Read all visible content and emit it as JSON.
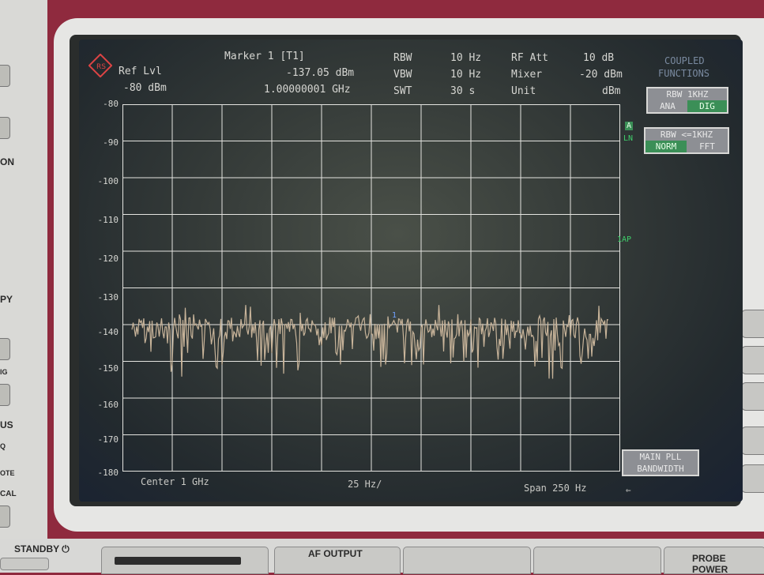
{
  "left_panel": {
    "labels": [
      "ON",
      "PY",
      "IG",
      "US",
      "Q",
      "OTE",
      "CAL"
    ]
  },
  "bottom_panel": {
    "standby": "STANDBY",
    "power_icon": "power-icon",
    "af_output": "AF OUTPUT",
    "probe_power": "PROBE POWER"
  },
  "screen": {
    "logo": "rohde-schwarz-logo",
    "ref_lvl_label": "Ref Lvl",
    "ref_lvl_value": "-80 dBm",
    "marker_label": "Marker 1 [T1]",
    "marker_level": "-137.05 dBm",
    "marker_freq": "1.00000001 GHz",
    "rbw_label": "RBW",
    "rbw_value": "10 Hz",
    "vbw_label": "VBW",
    "vbw_value": "10 Hz",
    "swt_label": "SWT",
    "swt_value": "30 s",
    "rf_att_label": "RF Att",
    "rf_att_value": "10 dB",
    "mixer_label": "Mixer",
    "mixer_value": "-20 dBm",
    "unit_label": "Unit",
    "unit_value": "dBm",
    "trace_a": "A",
    "trace_lin": "LN",
    "trace_1ap": "1AP",
    "marker_tag": "1",
    "center_label": "Center 1 GHz",
    "div_label": "25 Hz/",
    "span_label": "Span 250 Hz",
    "y_ticks": [
      "-80",
      "-90",
      "-100",
      "-110",
      "-120",
      "-130",
      "-140",
      "-150",
      "-160",
      "-170",
      "-180"
    ]
  },
  "softkeys": {
    "coupled_functions_line1": "COUPLED",
    "coupled_functions_line2": "FUNCTIONS",
    "rbw_1khz_title": "RBW 1KHZ",
    "rbw_1khz_opt1": "ANA",
    "rbw_1khz_opt2": "DIG",
    "rbw_le1khz_title": "RBW <=1KHZ",
    "rbw_le1khz_opt1": "NORM",
    "rbw_le1khz_opt2": "FFT",
    "main_pll_line1": "MAIN PLL",
    "main_pll_line2": "BANDWIDTH"
  },
  "colors": {
    "trace": "#c8b49a",
    "grid": "#e4e4e0",
    "case_red": "#8f2a3e",
    "selected_option": "#3b8f57"
  }
}
